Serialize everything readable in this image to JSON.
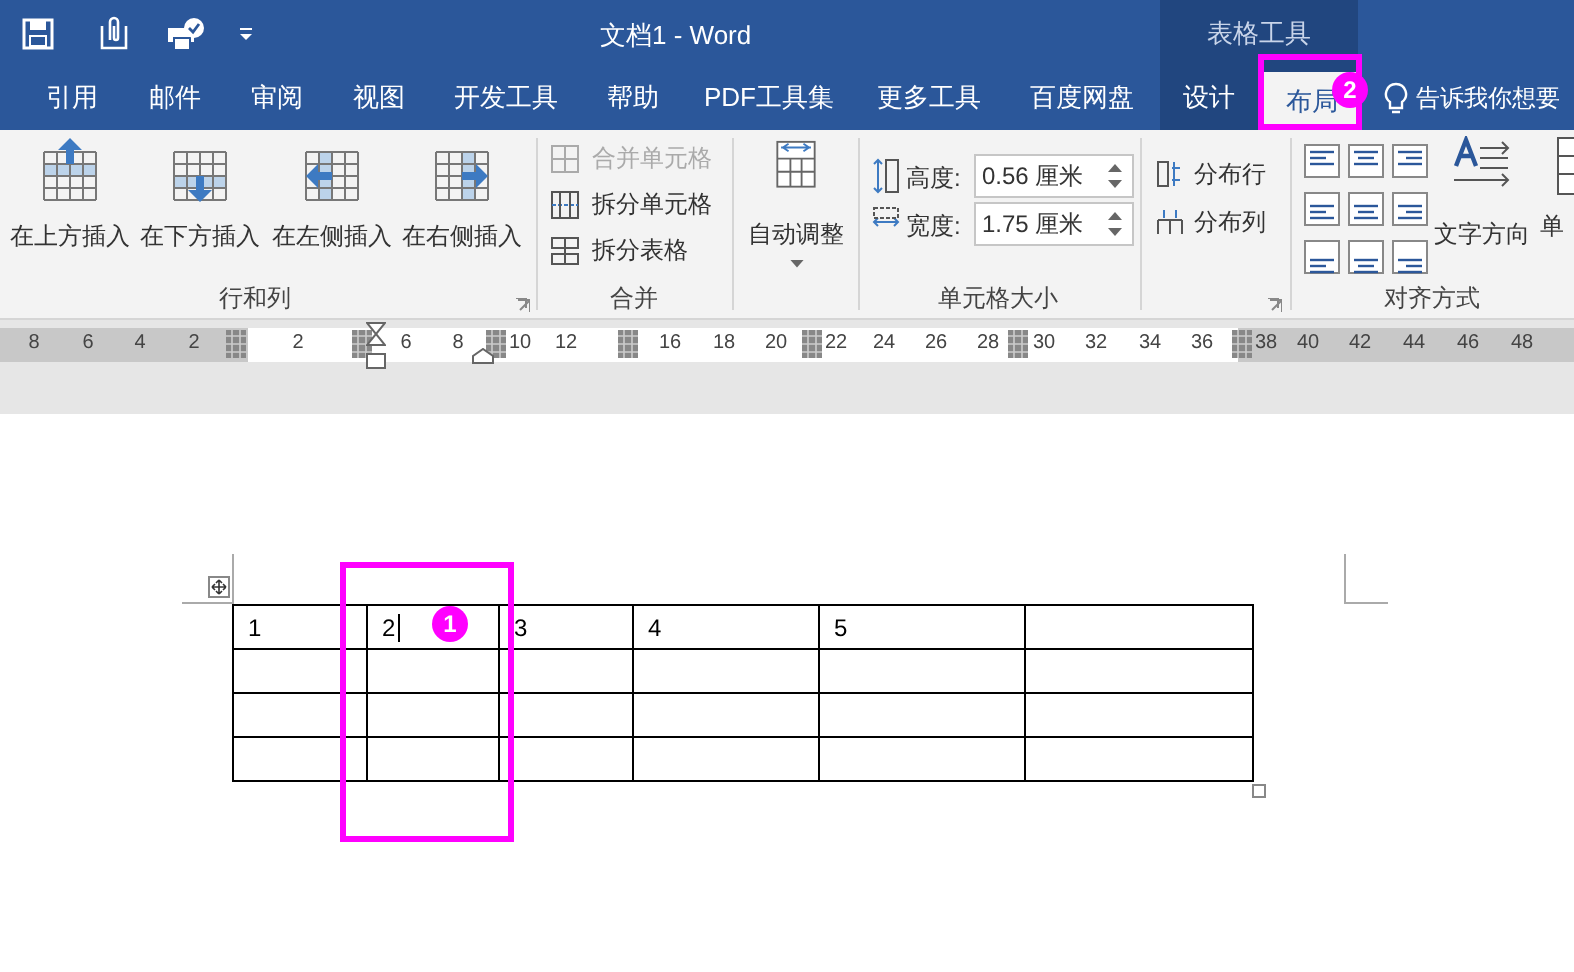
{
  "window": {
    "title": "文档1  -  Word",
    "context_group": "表格工具"
  },
  "tabs": [
    {
      "label": "引用",
      "selected": false,
      "contextual": false
    },
    {
      "label": "邮件",
      "selected": false,
      "contextual": false
    },
    {
      "label": "审阅",
      "selected": false,
      "contextual": false
    },
    {
      "label": "视图",
      "selected": false,
      "contextual": false
    },
    {
      "label": "开发工具",
      "selected": false,
      "contextual": false
    },
    {
      "label": "帮助",
      "selected": false,
      "contextual": false
    },
    {
      "label": "PDF工具集",
      "selected": false,
      "contextual": false
    },
    {
      "label": "更多工具",
      "selected": false,
      "contextual": false
    },
    {
      "label": "百度网盘",
      "selected": false,
      "contextual": false
    },
    {
      "label": "设计",
      "selected": false,
      "contextual": true
    },
    {
      "label": "布局",
      "selected": true,
      "contextual": true
    }
  ],
  "tell_me": "告诉我你想要",
  "ribbon": {
    "rows_columns": {
      "label": "行和列",
      "buttons": [
        "在上方插入",
        "在下方插入",
        "在左侧插入",
        "在右侧插入"
      ]
    },
    "merge": {
      "label": "合并",
      "buttons": [
        {
          "label": "合并单元格",
          "disabled": true
        },
        {
          "label": "拆分单元格",
          "disabled": false
        },
        {
          "label": "拆分表格",
          "disabled": false
        }
      ]
    },
    "cell_size": {
      "label": "单元格大小",
      "autofit": "自动调整",
      "spinners": [
        {
          "label": "高度:",
          "value": "0.56 厘米"
        },
        {
          "label": "宽度:",
          "value": "1.75 厘米"
        }
      ],
      "distribute": [
        "分布行",
        "分布列"
      ]
    },
    "alignment": {
      "label": "对齐方式",
      "text_direction": "文字方向",
      "cell_margins": [
        "单"
      ]
    }
  },
  "ruler": [
    "8",
    "6",
    "4",
    "2",
    "2",
    "6",
    "8",
    "10",
    "12",
    "16",
    "18",
    "20",
    "22",
    "24",
    "26",
    "28",
    "30",
    "32",
    "34",
    "36",
    "38",
    "40",
    "42",
    "44",
    "46",
    "48"
  ],
  "table": {
    "rows": [
      {
        "cells": [
          {
            "text": "1",
            "caret": false
          },
          {
            "text": "2",
            "caret": true
          },
          {
            "text": "3",
            "caret": false
          },
          {
            "text": "4",
            "caret": false
          },
          {
            "text": "5",
            "caret": false
          }
        ]
      }
    ]
  },
  "annotations": [
    {
      "label": "1"
    },
    {
      "label": "2"
    }
  ]
}
